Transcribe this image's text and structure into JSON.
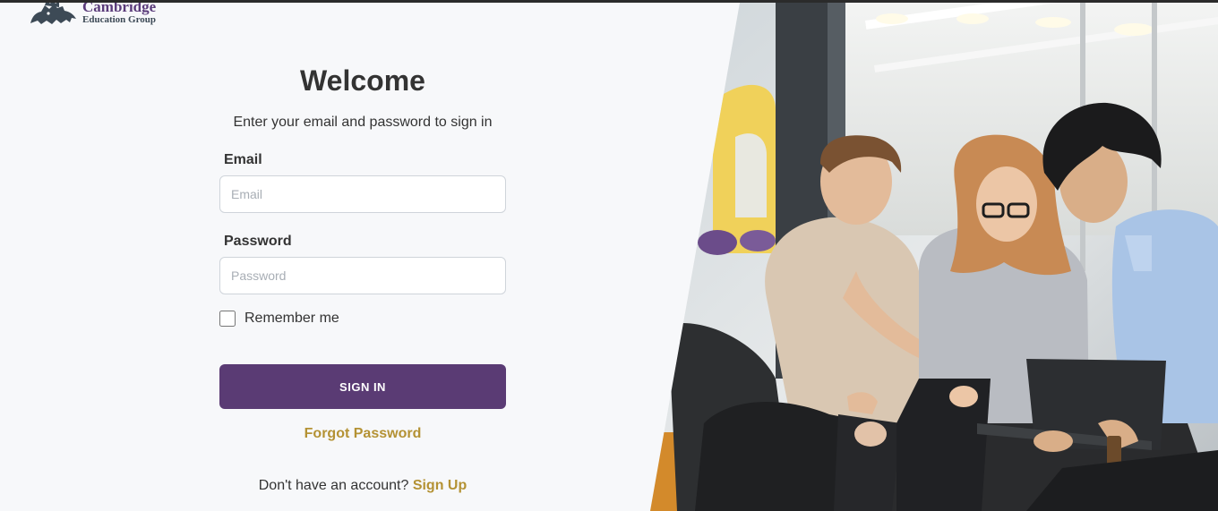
{
  "brand": {
    "name": "Cambridge",
    "tagline": "Education Group",
    "logo_icon": "lion-crest-icon",
    "colors": {
      "primary": "#5a3b74",
      "accent": "#b49234",
      "navy": "#3d4a56"
    }
  },
  "login": {
    "title": "Welcome",
    "subtitle": "Enter your email and password to sign in",
    "email_label": "Email",
    "email_placeholder": "Email",
    "email_value": "",
    "password_label": "Password",
    "password_placeholder": "Password",
    "password_value": "",
    "remember_label": "Remember me",
    "remember_checked": false,
    "signin_label": "SIGN IN",
    "forgot_label": "Forgot Password",
    "signup_prompt": "Don't have an account?",
    "signup_label": "Sign Up"
  },
  "hero_image": {
    "icon": "students-with-laptop-photo"
  }
}
